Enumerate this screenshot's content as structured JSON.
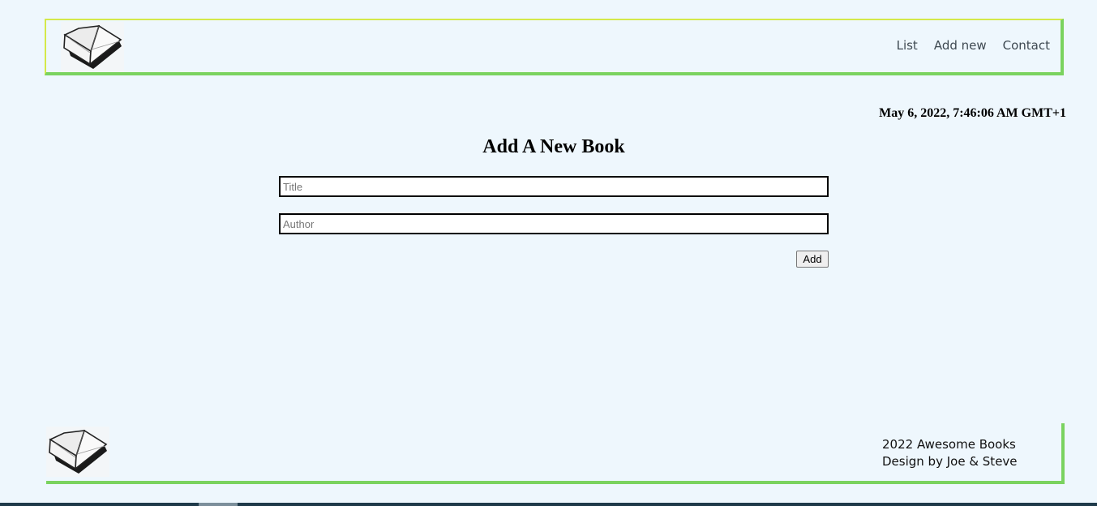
{
  "header": {
    "logo_icon": "open-book-icon",
    "nav": [
      {
        "label": "List"
      },
      {
        "label": "Add new"
      },
      {
        "label": "Contact"
      }
    ]
  },
  "main": {
    "datetime": "May 6, 2022, 7:46:06 AM GMT+1",
    "title": "Add A New Book",
    "title_input": {
      "placeholder": "Title",
      "value": ""
    },
    "author_input": {
      "placeholder": "Author",
      "value": ""
    },
    "add_label": "Add"
  },
  "footer": {
    "logo_icon": "open-book-icon",
    "line1": "2022 Awesome Books",
    "line2": "Design by Joe & Steve"
  },
  "colors": {
    "background": "#eef7fd",
    "accent_green": "#7ad35f",
    "accent_yellow": "#d4e94a"
  }
}
